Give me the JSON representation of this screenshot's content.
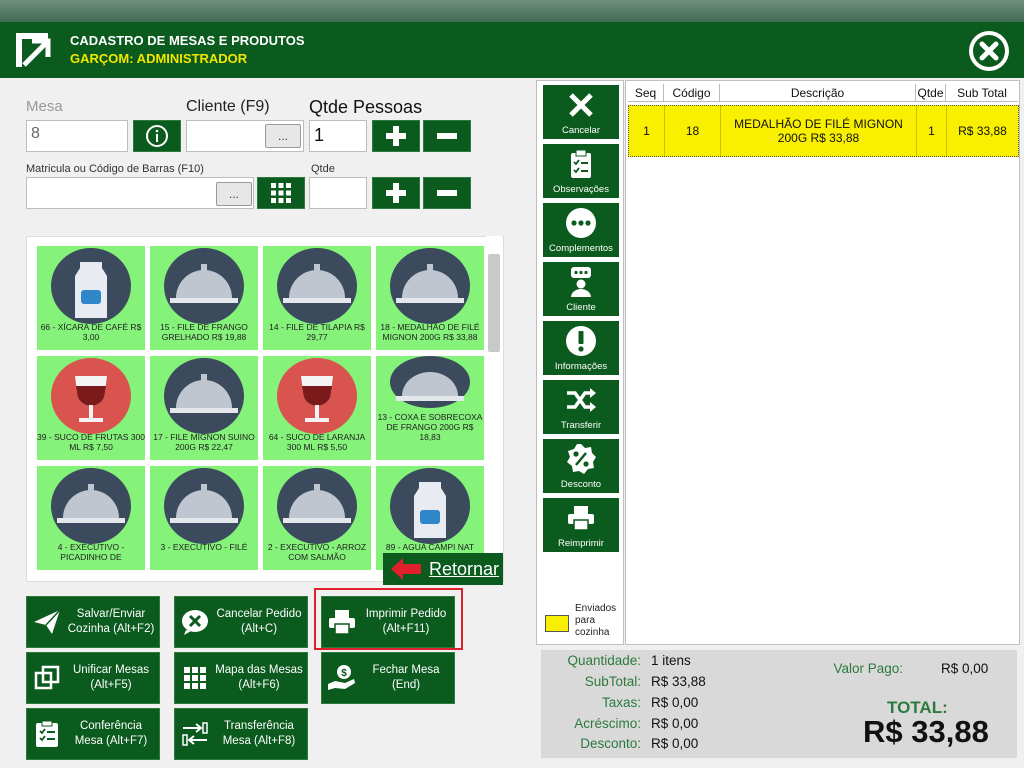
{
  "header": {
    "title": "CADASTRO DE MESAS E PRODUTOS",
    "subtitle": "GARÇOM: ADMINISTRADOR"
  },
  "form": {
    "mesa_label": "Mesa",
    "mesa_value": "8",
    "cliente_label": "Cliente (F9)",
    "cliente_value": "",
    "dots": "...",
    "qtde_pessoas_label": "Qtde Pessoas",
    "qtde_pessoas_value": "1",
    "matricula_label": "Matricula ou Código de Barras (F10)",
    "matricula_value": "",
    "qtde_label": "Qtde",
    "qtde_value": ""
  },
  "products": [
    {
      "label": "66 - XÍCARA DE CAFÉ R$ 3,00",
      "icon": "milk-carton-icon"
    },
    {
      "label": "15 - FILE DE FRANGO GRELHADO R$ 19,88",
      "icon": "cloche-icon"
    },
    {
      "label": "14 - FILE DE TILAPIA R$ 29,77",
      "icon": "cloche-icon"
    },
    {
      "label": "18 - MEDALHÃO DE FILÉ MIGNON 200G R$ 33,88",
      "icon": "cloche-icon"
    },
    {
      "label": "39 - SUCO DE FRUTAS 300 ML R$ 7,50",
      "icon": "wine-glass-icon"
    },
    {
      "label": "17 - FILE MIGNON SUINO 200G R$ 22,47",
      "icon": "cloche-icon"
    },
    {
      "label": "64 - SUCO DE LARANJA 300 ML R$ 5,50",
      "icon": "wine-glass-icon"
    },
    {
      "label": "13 - COXA E SOBRECOXA DE FRANGO 200G R$ 18,83",
      "icon": "cloche-icon"
    },
    {
      "label": "4 - EXECUTIVO - PICADINHO DE",
      "icon": "cloche-icon"
    },
    {
      "label": "3 - EXECUTIVO - FILÉ",
      "icon": "cloche-icon"
    },
    {
      "label": "2 - EXECUTIVO - ARROZ COM SALMÃO",
      "icon": "cloche-icon"
    },
    {
      "label": "89 - AGUA CAMPI NAT",
      "icon": "milk-carton-icon"
    }
  ],
  "retornar_label": "Retornar",
  "actions": {
    "salvar": "Salvar/Enviar Cozinha (Alt+F2)",
    "cancelar": "Cancelar Pedido (Alt+C)",
    "imprimir": "Imprimir Pedido (Alt+F11)",
    "unificar": "Unificar Mesas (Alt+F5)",
    "mapa": "Mapa das Mesas (Alt+F6)",
    "fechar": "Fechar Mesa (End)",
    "conferencia": "Conferência Mesa (Alt+F7)",
    "transferencia": "Transferência Mesa (Alt+F8)"
  },
  "side_buttons": {
    "cancelar": "Cancelar",
    "observacoes": "Observações",
    "complementos": "Complementos",
    "cliente": "Cliente",
    "informacoes": "Informações",
    "transferir": "Transferir",
    "desconto": "Desconto",
    "reimprimir": "Reimprimir"
  },
  "legend": "Enviados para cozinha",
  "table": {
    "columns": [
      "Seq",
      "Código",
      "Descrição",
      "Qtde",
      "Sub Total"
    ],
    "rows": [
      {
        "seq": "1",
        "codigo": "18",
        "descricao": "MEDALHÃO DE FILÉ MIGNON 200G R$ 33,88",
        "qtde": "1",
        "subtotal": "R$ 33,88"
      }
    ]
  },
  "totals": {
    "quantidade_label": "Quantidade:",
    "quantidade_value": "1 itens",
    "subtotal_label": "SubTotal:",
    "subtotal_value": "R$ 33,88",
    "taxas_label": "Taxas:",
    "taxas_value": "R$ 0,00",
    "acrescimo_label": "Acréscimo:",
    "acrescimo_value": "R$ 0,00",
    "desconto_label": "Desconto:",
    "desconto_value": "R$ 0,00",
    "valor_pago_label": "Valor Pago:",
    "valor_pago_value": "R$ 0,00",
    "total_label": "TOTAL:",
    "total_value": "R$ 33,88"
  },
  "colors": {
    "brand_green": "#0b5a1e",
    "product_tile": "#85f27a",
    "sent_to_kitchen": "#f8f000",
    "highlight": "#e0202a"
  }
}
